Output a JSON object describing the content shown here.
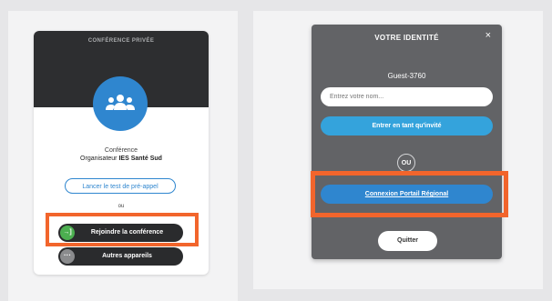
{
  "left_card": {
    "header_title": "CONFÉRENCE PRIVÉE",
    "avatar_icon": "group-icon",
    "conference_label": "Conférence",
    "organizer_prefix": "Organisateur",
    "organizer_name": "IES Santé Sud",
    "pretest_button": "Lancer le test de pré-appel",
    "or_text": "ou",
    "join_button": "Rejoindre la conférence",
    "join_icon": "enter-icon",
    "join_icon_glyph": "→]",
    "other_devices_button": "Autres appareils",
    "other_devices_icon": "more-icon",
    "other_devices_icon_glyph": "···"
  },
  "dialog": {
    "title": "VOTRE IDENTITÉ",
    "close_glyph": "×",
    "guest_id": "Guest-3760",
    "name_input_placeholder": "Entrez votre nom...",
    "name_input_value": "",
    "guest_button": "Entrer en tant qu'invité",
    "or_text": "OU",
    "regional_button": "Connexion Portail Régional",
    "quit_button": "Quitter"
  },
  "colors": {
    "highlight": "#f2652c",
    "primary_blue": "#2f86cf",
    "light_blue": "#34a3dc",
    "dark": "#2a2b2d",
    "dialog_bg": "#626366",
    "join_icon_green": "#4caf50"
  }
}
